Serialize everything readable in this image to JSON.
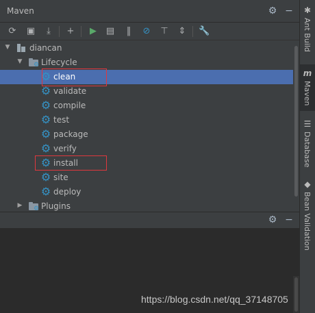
{
  "panel": {
    "title": "Maven"
  },
  "toolbar": {
    "reimport": "⟳",
    "generate_sources": "▣",
    "download": "⤓",
    "add": "+",
    "run": "▶",
    "run_config": "▤",
    "toggle_offline": "‖",
    "skip_tests": "⊘",
    "show_dependencies": "⊤",
    "collapse_all": "⇕",
    "settings": "🔧"
  },
  "tree": {
    "project": "diancan",
    "lifecycle": "Lifecycle",
    "phases": [
      "clean",
      "validate",
      "compile",
      "test",
      "package",
      "verify",
      "install",
      "site",
      "deploy"
    ],
    "plugins": "Plugins"
  },
  "side_tabs": {
    "ant": "Ant Build",
    "maven": "Maven",
    "database": "Database",
    "bean": "Bean Validation"
  },
  "watermark": "https://blog.csdn.net/qq_37148705",
  "colors": {
    "selection": "#4b6eaf",
    "highlight_box": "#e0383e",
    "gear": "#3592c4"
  }
}
